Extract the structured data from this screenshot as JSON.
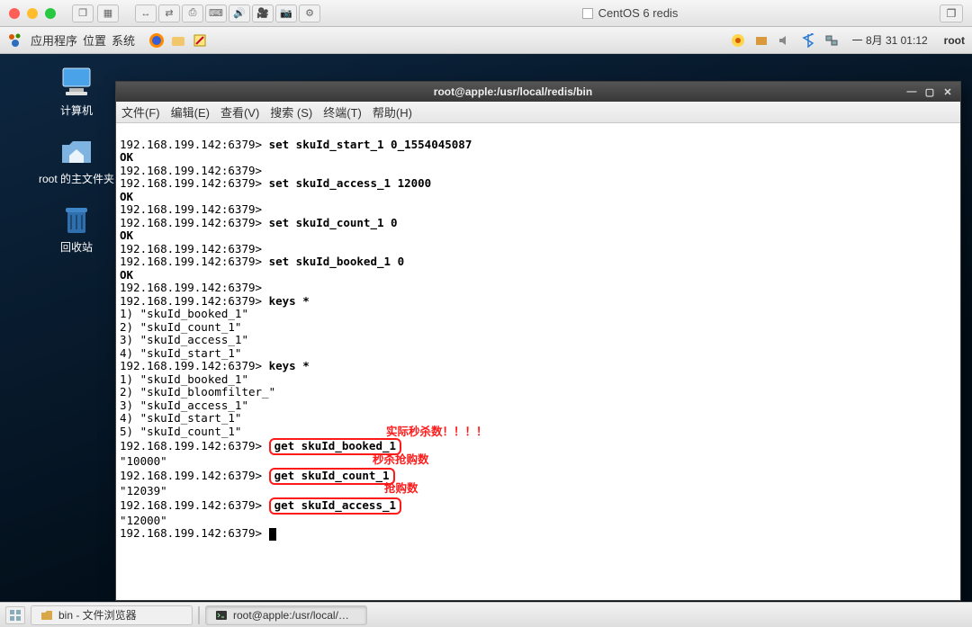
{
  "host_window": {
    "title": "CentOS 6 redis"
  },
  "gnome_panel": {
    "apps_label": "应用程序",
    "places_label": "位置",
    "system_label": "系统",
    "clock": "一 8月 31 01:12",
    "user": "root"
  },
  "desktop_icons": {
    "computer": "计算机",
    "root_home": "root 的主文件夹",
    "trash": "回收站"
  },
  "terminal": {
    "title": "root@apple:/usr/local/redis/bin",
    "menus": [
      "文件(F)",
      "编辑(E)",
      "查看(V)",
      "搜索 (S)",
      "终端(T)",
      "帮助(H)"
    ],
    "prompt": "192.168.199.142:6379>",
    "ok": "OK",
    "cmds": {
      "set_start": "set skuId_start_1 0_1554045087",
      "set_access": "set skuId_access_1 12000",
      "set_count": "set skuId_count_1 0",
      "set_booked": "set skuId_booked_1 0",
      "keys": "keys *",
      "get_booked": "get skuId_booked_1",
      "get_count": "get skuId_count_1",
      "get_access": "get skuId_access_1"
    },
    "keys_result_1": [
      "1) \"skuId_booked_1\"",
      "2) \"skuId_count_1\"",
      "3) \"skuId_access_1\"",
      "4) \"skuId_start_1\""
    ],
    "keys_result_2": [
      "1) \"skuId_booked_1\"",
      "2) \"skuId_bloomfilter_\"",
      "3) \"skuId_access_1\"",
      "4) \"skuId_start_1\"",
      "5) \"skuId_count_1\""
    ],
    "val_booked": "\"10000\"",
    "val_count": "\"12039\"",
    "val_access": "\"12000\"",
    "annotations": {
      "booked": "实际秒杀数！！！！",
      "count": "秒杀抢购数",
      "access": "抢购数"
    }
  },
  "bottom_bar": {
    "task1": "bin - 文件浏览器",
    "task2": "root@apple:/usr/local/…"
  }
}
